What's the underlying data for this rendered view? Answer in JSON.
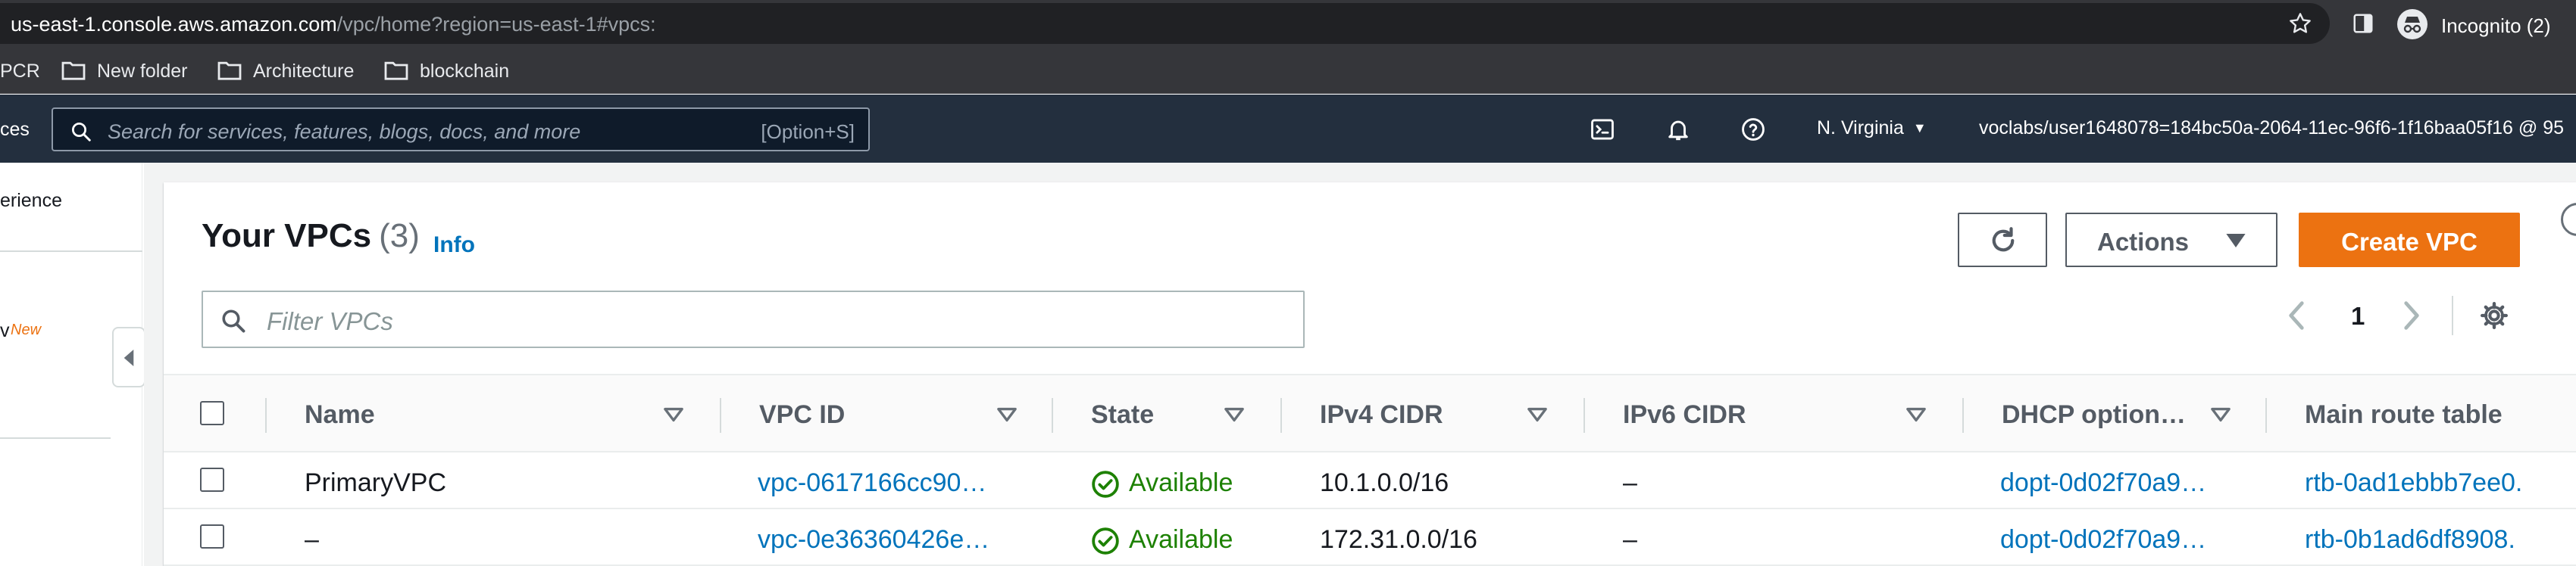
{
  "browser": {
    "url_host": "us-east-1.console.aws.amazon.com",
    "url_rest": "/vpc/home?region=us-east-1#vpcs:",
    "profile_label": "Incognito (2)"
  },
  "bookmarks": [
    {
      "label": "PCR",
      "icon": "none"
    },
    {
      "label": "New folder",
      "icon": "folder-icon"
    },
    {
      "label": "Architecture",
      "icon": "folder-icon"
    },
    {
      "label": "blockchain",
      "icon": "folder-icon"
    }
  ],
  "aws_nav": {
    "services_cut": "ces",
    "search_placeholder": "Search for services, features, blogs, docs, and more",
    "search_shortcut": "[Option+S]",
    "region": "N. Virginia",
    "account": "voclabs/user1648078=184bc50a-2064-11ec-96f6-1f16baa05f16 @ 95"
  },
  "left_nav": {
    "experience_cut": "erience",
    "new_prefix_cut": "v",
    "new_badge": "New"
  },
  "vpcs": {
    "title": "Your VPCs",
    "count": "(3)",
    "info": "Info",
    "actions_label": "Actions",
    "create_label": "Create VPC",
    "filter_placeholder": "Filter VPCs",
    "page": "1",
    "columns": [
      "Name",
      "VPC ID",
      "State",
      "IPv4 CIDR",
      "IPv6 CIDR",
      "DHCP option…",
      "Main route table"
    ],
    "rows": [
      {
        "name": "PrimaryVPC",
        "vpc_id": "vpc-0617166cc90…",
        "state": "Available",
        "ipv4": "10.1.0.0/16",
        "ipv6": "–",
        "dhcp": "dopt-0d02f70a9…",
        "route": "rtb-0ad1ebbb7ee0."
      },
      {
        "name": "–",
        "vpc_id": "vpc-0e36360426e…",
        "state": "Available",
        "ipv4": "172.31.0.0/16",
        "ipv6": "–",
        "dhcp": "dopt-0d02f70a9…",
        "route": "rtb-0b1ad6df8908."
      }
    ]
  },
  "colors": {
    "aws_nav_bg": "#232f3e",
    "primary_button": "#ec7211",
    "link": "#0073bb",
    "available": "#1d8102"
  }
}
